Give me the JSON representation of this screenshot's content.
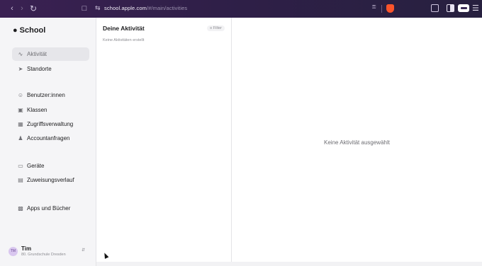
{
  "browser": {
    "url_host": "school.apple.com",
    "url_path": "/#/main/activities"
  },
  "sidebar": {
    "app_name": "School",
    "items": [
      {
        "label": "Aktivität",
        "icon": "activity-icon",
        "active": true
      },
      {
        "label": "Standorte",
        "icon": "location-arrow-icon"
      },
      {
        "label": "Benutzer:innen",
        "icon": "users-icon"
      },
      {
        "label": "Klassen",
        "icon": "class-icon"
      },
      {
        "label": "Zugriffsverwaltung",
        "icon": "access-icon"
      },
      {
        "label": "Accountanfragen",
        "icon": "account-request-icon"
      },
      {
        "label": "Geräte",
        "icon": "laptop-icon"
      },
      {
        "label": "Zuweisungsverlauf",
        "icon": "assignment-history-icon"
      },
      {
        "label": "Apps und Bücher",
        "icon": "apps-books-icon"
      }
    ],
    "user": {
      "initials": "TM",
      "name": "Tim",
      "school": "80. Grundschule Dresden"
    }
  },
  "list": {
    "title": "Deine Aktivität",
    "filter_label": "Filter",
    "empty_text": "Keine Aktivitäten erstellt"
  },
  "detail": {
    "empty_text": "Keine Aktivität ausgewählt"
  }
}
